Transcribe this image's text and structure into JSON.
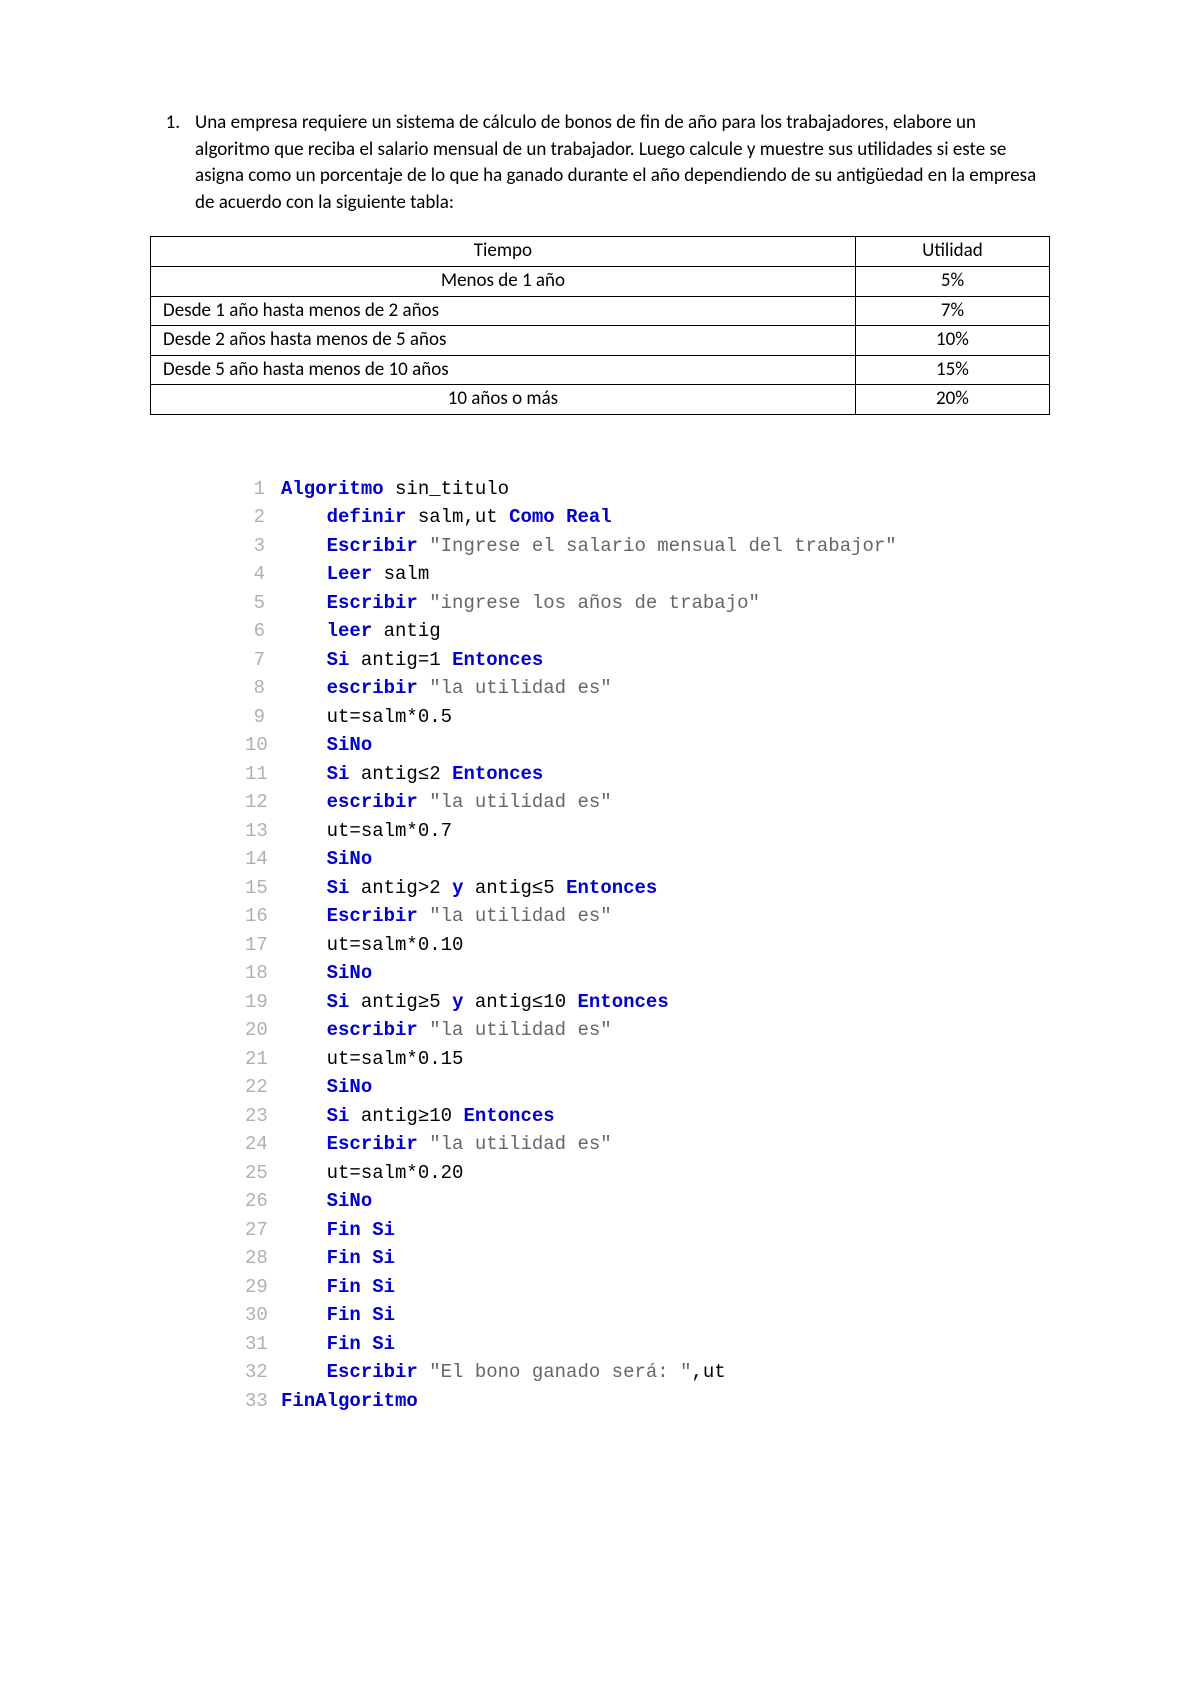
{
  "problem": {
    "number": "1.",
    "text": "Una empresa requiere un sistema de cálculo de bonos de fin de año para los trabajadores, elabore un algoritmo que reciba el salario mensual de un trabajador. Luego calcule y muestre sus utilidades si este se asigna como un porcentaje de lo que ha ganado durante el año dependiendo de su antigüedad en la empresa de acuerdo con la siguiente tabla:"
  },
  "table": {
    "headers": [
      "Tiempo",
      "Utilidad"
    ],
    "rows": [
      {
        "time": "Menos de 1 año",
        "utility": "5%"
      },
      {
        "time": "Desde 1 año hasta menos de 2 años",
        "utility": "7%"
      },
      {
        "time": "Desde 2 años hasta menos de 5 años",
        "utility": "10%"
      },
      {
        "time": "Desde 5 año hasta menos de 10 años",
        "utility": "15%"
      },
      {
        "time": "10 años o más",
        "utility": "20%"
      }
    ]
  },
  "code": {
    "indent_kw": {
      "algoritmo": "Algoritmo",
      "definir": "definir",
      "escribir": "Escribir",
      "escribir_lc": "escribir",
      "leer": "Leer",
      "leer_lc": "leer",
      "si": "Si",
      "entonces": "Entonces",
      "sino": "SiNo",
      "y": "y",
      "finsi": "Fin Si",
      "como_real": "Como Real",
      "finalgoritmo": "FinAlgoritmo"
    },
    "vars": {
      "sin_titulo": "sin_titulo",
      "salm_ut": "salm,ut",
      "salm": "salm",
      "antig": "antig",
      "ut": "ut"
    },
    "strings": {
      "s3": "\"Ingrese el salario mensual del trabajor\"",
      "s5": "\"ingrese los años de trabajo\"",
      "s_util": "\"la utilidad es\"",
      "s32a": "\"El bono ganado será: \""
    },
    "expr": {
      "e7": "antig=1",
      "e9": "ut=salm*0.5",
      "e11": "antig≤2",
      "e13": "ut=salm*0.7",
      "e15a": "antig>2",
      "e15b": "antig≤5",
      "e17": "ut=salm*0.10",
      "e19a": "antig≥5",
      "e19b": "antig≤10",
      "e21": "ut=salm*0.15",
      "e23": "antig≥10",
      "e25": "ut=salm*0.20"
    },
    "nums": [
      "1",
      "2",
      "3",
      "4",
      "5",
      "6",
      "7",
      "8",
      "9",
      "10",
      "11",
      "12",
      "13",
      "14",
      "15",
      "16",
      "17",
      "18",
      "19",
      "20",
      "21",
      "22",
      "23",
      "24",
      "25",
      "26",
      "27",
      "28",
      "29",
      "30",
      "31",
      "32",
      "33"
    ]
  }
}
